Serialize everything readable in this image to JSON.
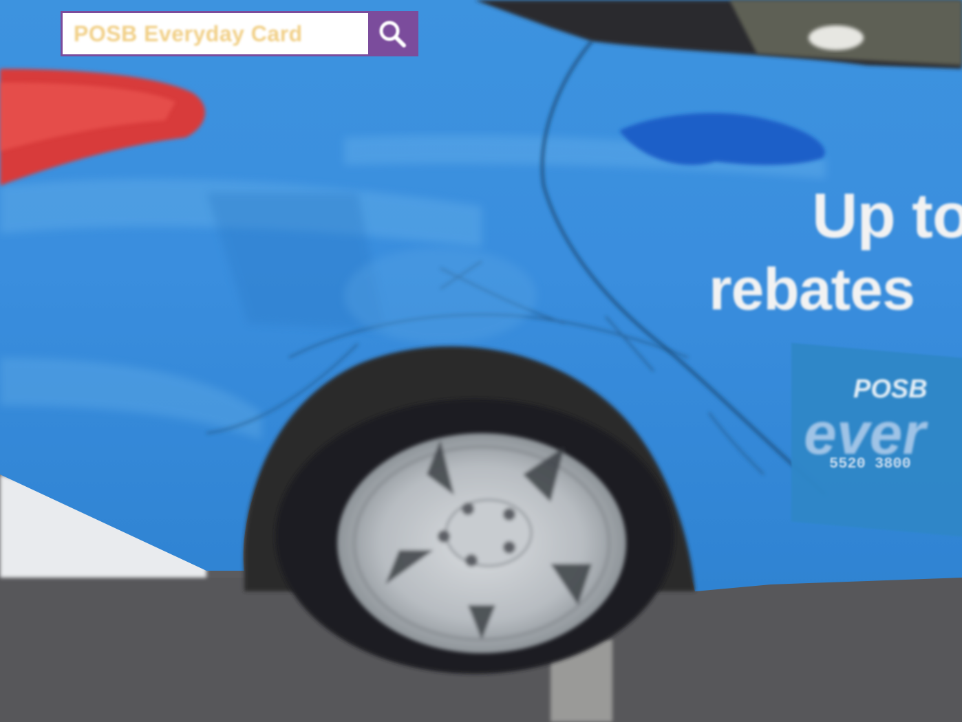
{
  "sticker": {
    "text": "POSB Everyday Card",
    "icon": "search-icon"
  },
  "advert": {
    "headline": "Up to",
    "subline": "rebates",
    "card": {
      "brand": "POSB",
      "product": "ever",
      "number": "5520 3800"
    }
  },
  "colors": {
    "car_body": "#3b8fdb",
    "brand_purple": "#7b4c9c",
    "tail_light": "#d83a3a",
    "door_handle": "#1f5fc8",
    "wheel": "#c2c6cb",
    "asphalt": "#5a5a5d"
  }
}
